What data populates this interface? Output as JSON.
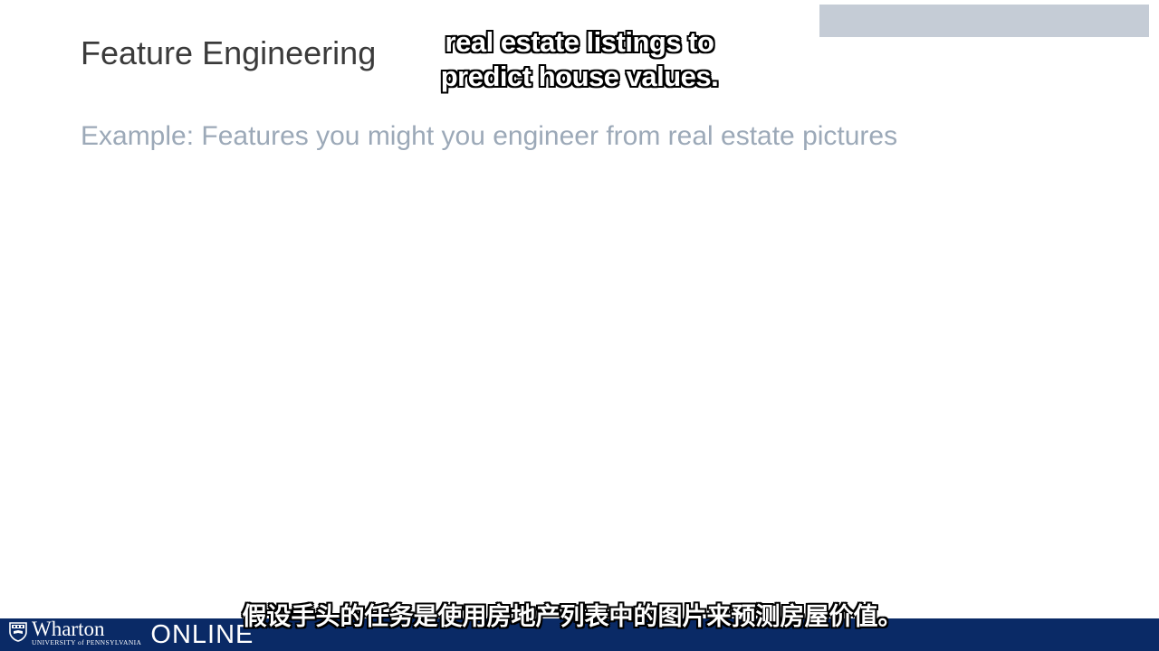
{
  "slide": {
    "title": "Feature Engineering",
    "subtitle": "Example: Features you might you engineer from real estate pictures",
    "top_bar_text": "",
    "colors": {
      "title": "#3b3b3b",
      "subtitle": "#9ca9b8",
      "footer": "#0a2a66",
      "top_bar": "#c5ccd6"
    }
  },
  "caption_overlay": {
    "line1": "real estate listings to",
    "line2": "predict house values."
  },
  "footer": {
    "logo_wordmark": "Wharton",
    "logo_university": "UNIVERSITY of PENNSYLVANIA",
    "logo_online": "ONLINE",
    "logo_icon": "penn-shield-icon"
  },
  "subtitles": {
    "chinese": "假设手头的任务是使用房地产列表中的图片来预测房屋价值。"
  }
}
